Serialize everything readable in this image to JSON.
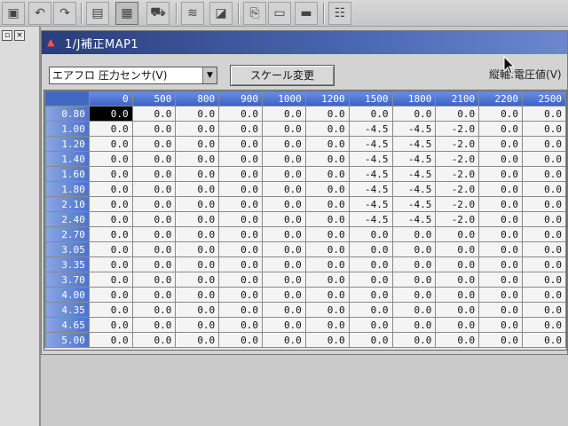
{
  "window": {
    "title": "1/J補正MAP1"
  },
  "controls": {
    "axis_select": "エアフロ 圧力センサ(V)",
    "scale_button": "スケール変更",
    "vertical_axis_label": "縦軸:電圧値(V)"
  },
  "map": {
    "columns": [
      "0",
      "500",
      "800",
      "900",
      "1000",
      "1200",
      "1500",
      "1800",
      "2100",
      "2200",
      "2500"
    ],
    "rows": [
      {
        "label": "0.80",
        "values": [
          "0.0",
          "0.0",
          "0.0",
          "0.0",
          "0.0",
          "0.0",
          "0.0",
          "0.0",
          "0.0",
          "0.0",
          "0.0"
        ]
      },
      {
        "label": "1.00",
        "values": [
          "0.0",
          "0.0",
          "0.0",
          "0.0",
          "0.0",
          "0.0",
          "-4.5",
          "-4.5",
          "-2.0",
          "0.0",
          "0.0"
        ]
      },
      {
        "label": "1.20",
        "values": [
          "0.0",
          "0.0",
          "0.0",
          "0.0",
          "0.0",
          "0.0",
          "-4.5",
          "-4.5",
          "-2.0",
          "0.0",
          "0.0"
        ]
      },
      {
        "label": "1.40",
        "values": [
          "0.0",
          "0.0",
          "0.0",
          "0.0",
          "0.0",
          "0.0",
          "-4.5",
          "-4.5",
          "-2.0",
          "0.0",
          "0.0"
        ]
      },
      {
        "label": "1.60",
        "values": [
          "0.0",
          "0.0",
          "0.0",
          "0.0",
          "0.0",
          "0.0",
          "-4.5",
          "-4.5",
          "-2.0",
          "0.0",
          "0.0"
        ]
      },
      {
        "label": "1.80",
        "values": [
          "0.0",
          "0.0",
          "0.0",
          "0.0",
          "0.0",
          "0.0",
          "-4.5",
          "-4.5",
          "-2.0",
          "0.0",
          "0.0"
        ]
      },
      {
        "label": "2.10",
        "values": [
          "0.0",
          "0.0",
          "0.0",
          "0.0",
          "0.0",
          "0.0",
          "-4.5",
          "-4.5",
          "-2.0",
          "0.0",
          "0.0"
        ]
      },
      {
        "label": "2.40",
        "values": [
          "0.0",
          "0.0",
          "0.0",
          "0.0",
          "0.0",
          "0.0",
          "-4.5",
          "-4.5",
          "-2.0",
          "0.0",
          "0.0"
        ]
      },
      {
        "label": "2.70",
        "values": [
          "0.0",
          "0.0",
          "0.0",
          "0.0",
          "0.0",
          "0.0",
          "0.0",
          "0.0",
          "0.0",
          "0.0",
          "0.0"
        ]
      },
      {
        "label": "3.05",
        "values": [
          "0.0",
          "0.0",
          "0.0",
          "0.0",
          "0.0",
          "0.0",
          "0.0",
          "0.0",
          "0.0",
          "0.0",
          "0.0"
        ]
      },
      {
        "label": "3.35",
        "values": [
          "0.0",
          "0.0",
          "0.0",
          "0.0",
          "0.0",
          "0.0",
          "0.0",
          "0.0",
          "0.0",
          "0.0",
          "0.0"
        ]
      },
      {
        "label": "3.70",
        "values": [
          "0.0",
          "0.0",
          "0.0",
          "0.0",
          "0.0",
          "0.0",
          "0.0",
          "0.0",
          "0.0",
          "0.0",
          "0.0"
        ]
      },
      {
        "label": "4.00",
        "values": [
          "0.0",
          "0.0",
          "0.0",
          "0.0",
          "0.0",
          "0.0",
          "0.0",
          "0.0",
          "0.0",
          "0.0",
          "0.0"
        ]
      },
      {
        "label": "4.35",
        "values": [
          "0.0",
          "0.0",
          "0.0",
          "0.0",
          "0.0",
          "0.0",
          "0.0",
          "0.0",
          "0.0",
          "0.0",
          "0.0"
        ]
      },
      {
        "label": "4.65",
        "values": [
          "0.0",
          "0.0",
          "0.0",
          "0.0",
          "0.0",
          "0.0",
          "0.0",
          "0.0",
          "0.0",
          "0.0",
          "0.0"
        ]
      },
      {
        "label": "5.00",
        "values": [
          "0.0",
          "0.0",
          "0.0",
          "0.0",
          "0.0",
          "0.0",
          "0.0",
          "0.0",
          "0.0",
          "0.0",
          "0.0"
        ]
      }
    ],
    "selected": {
      "row": 0,
      "col": 0
    }
  },
  "colors": {
    "header_blue": "#3a62c8",
    "titlebar": "#2a3d7a",
    "selected_cell": "#000000"
  },
  "icons": {
    "toolbar": [
      "save-icon",
      "undo-icon",
      "redo-icon",
      "table-icon",
      "map-view-icon",
      "car-icon",
      "graph-icon",
      "chart-icon",
      "export-icon",
      "import-icon",
      "print-icon",
      "settings-icon"
    ]
  }
}
